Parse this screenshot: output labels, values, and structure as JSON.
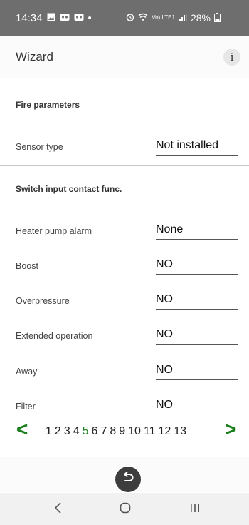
{
  "status_bar": {
    "time": "14:34",
    "dot": "•",
    "battery": "28%",
    "network": "Vo) LTE1"
  },
  "app_bar": {
    "title": "Wizard",
    "info_label": "i"
  },
  "sections": [
    {
      "label": "Fire parameters"
    },
    {
      "label": "Switch input contact func."
    }
  ],
  "rows": [
    {
      "label": "Sensor type",
      "value": "Not installed"
    },
    {
      "label": "Heater pump alarm",
      "value": "None"
    },
    {
      "label": "Boost",
      "value": "NO"
    },
    {
      "label": "Overpressure",
      "value": "NO"
    },
    {
      "label": "Extended operation",
      "value": "NO"
    },
    {
      "label": "Away",
      "value": "NO"
    },
    {
      "label": "Filter",
      "value": "NO"
    }
  ],
  "pager": {
    "prev": "<",
    "next": ">",
    "pages": [
      "1",
      "2",
      "3",
      "4",
      "5",
      "6",
      "7",
      "8",
      "9",
      "10",
      "11",
      "12",
      "13"
    ],
    "current": "5"
  },
  "colors": {
    "accent": "#1a7f1a",
    "status_bar": "#6e6e6e"
  }
}
